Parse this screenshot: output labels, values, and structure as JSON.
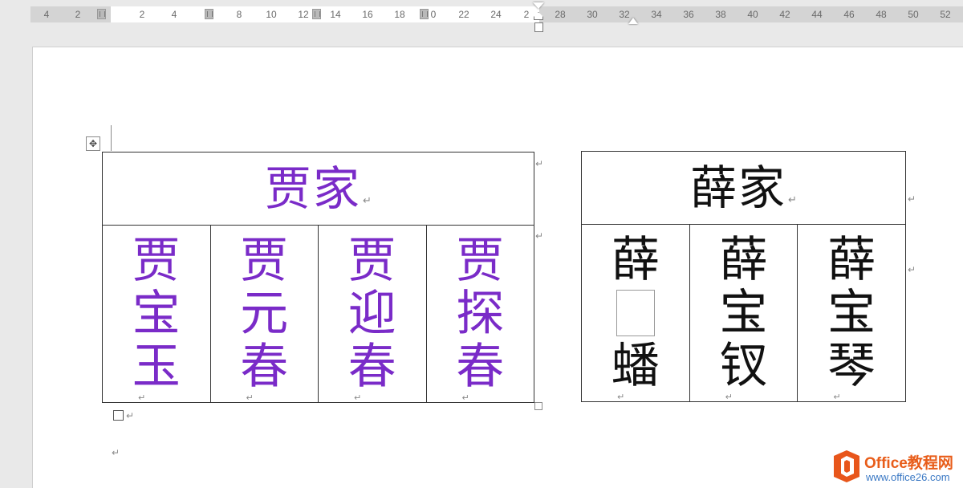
{
  "ruler": {
    "labels": [
      {
        "text": "4"
      },
      {
        "text": "2"
      },
      {
        "text": "2"
      },
      {
        "text": "4"
      },
      {
        "text": "8"
      },
      {
        "text": "10"
      },
      {
        "text": "12"
      },
      {
        "text": "14"
      },
      {
        "text": "16"
      },
      {
        "text": "18"
      },
      {
        "text": "0"
      },
      {
        "text": "22"
      },
      {
        "text": "24"
      },
      {
        "text": "2"
      },
      {
        "text": "28"
      },
      {
        "text": "30"
      },
      {
        "text": "32"
      },
      {
        "text": "34"
      },
      {
        "text": "36"
      },
      {
        "text": "38"
      },
      {
        "text": "40"
      },
      {
        "text": "42"
      },
      {
        "text": "44"
      },
      {
        "text": "46"
      },
      {
        "text": "48"
      },
      {
        "text": "50"
      },
      {
        "text": "52"
      }
    ]
  },
  "jia_table": {
    "header": "贾家",
    "color": "#7a2bc8",
    "members": [
      {
        "chars": [
          "贾",
          "宝",
          "玉"
        ]
      },
      {
        "chars": [
          "贾",
          "元",
          "春"
        ]
      },
      {
        "chars": [
          "贾",
          "迎",
          "春"
        ]
      },
      {
        "chars": [
          "贾",
          "探",
          "春"
        ]
      }
    ]
  },
  "xue_table": {
    "header": "薛家",
    "color": "#111111",
    "members": [
      {
        "chars": [
          "薛",
          "",
          "蟠"
        ]
      },
      {
        "chars": [
          "薛",
          "宝",
          "钗"
        ]
      },
      {
        "chars": [
          "薛",
          "宝",
          "琴"
        ]
      }
    ]
  },
  "paragraph_mark": "↵",
  "watermark": {
    "title": "Office教程网",
    "url": "www.office26.com"
  }
}
